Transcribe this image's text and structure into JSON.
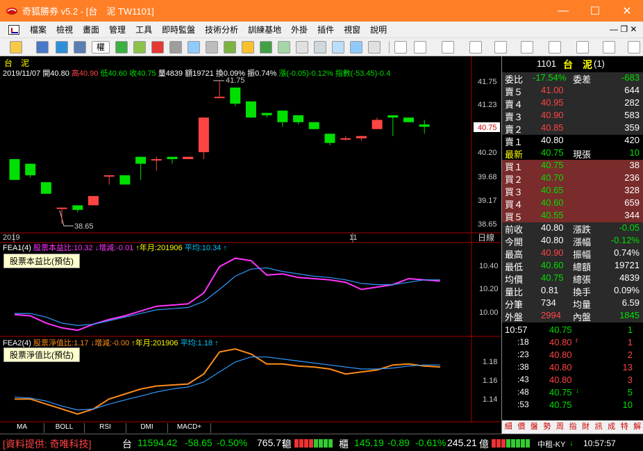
{
  "window": {
    "title": "奇狐勝券 v5.2 - [台　泥 TW1101]",
    "min_glyph": "—",
    "max_glyph": "☐",
    "close_glyph": "✕"
  },
  "menu": [
    "檔案",
    "檢視",
    "畫面",
    "管理",
    "工具",
    "即時監盤",
    "技術分析",
    "訓練基地",
    "外掛",
    "插件",
    "視窗",
    "說明"
  ],
  "mdi_controls": "—  ❐  ✕",
  "toolbar": {
    "right_label": "權"
  },
  "chart": {
    "stock_name": "台　泥",
    "header": {
      "date": "2019/11/07",
      "open": "開40.80",
      "high": "高40.90",
      "low": "低40.60",
      "close": "收40.75",
      "vol": "量4839",
      "amount": "額19721",
      "turnover": "換0.09%",
      "amplitude": "振0.74%",
      "change": "漲(-0.05)-0.12%",
      "index": "指數(-53.45)-0.4"
    },
    "hl_labels": {
      "high": "41.75",
      "low": "38.65"
    },
    "price_axis": [
      "41.75",
      "41.23",
      "40.70",
      "40.20",
      "39.68",
      "39.17",
      "38.65"
    ],
    "current_price_tag": "40.75",
    "x_labels": {
      "left": "2019",
      "mid": "11"
    },
    "period_label": "日線",
    "fea1": {
      "header_name": "FEA1(4)",
      "header_main": "股票本益比:10.32",
      "header_chg": "↓增減:-0.01",
      "header_month": "↑年月:201906",
      "header_avg": "平均:10.34",
      "header_arrow": "↑",
      "label": "股票本益比(預估)",
      "axis": [
        "10.40",
        "10.20",
        "10.00"
      ]
    },
    "fea2": {
      "header_name": "FEA2(4)",
      "header_main": "股票淨值比:1.17",
      "header_chg": "↓增減:-0.00",
      "header_month": "↑年月:201906",
      "header_avg": "平均:1.18",
      "header_arrow": "↑",
      "label": "股票淨值比(預估)",
      "axis": [
        "1.18",
        "1.16",
        "1.14"
      ]
    },
    "tabs": [
      "MA",
      "BOLL",
      "RSI",
      "DMI",
      "MACD+"
    ]
  },
  "chart_data": {
    "type": "candlestick",
    "ylim": [
      38.65,
      41.75
    ],
    "candles": [
      {
        "o": 40.05,
        "h": 40.05,
        "l": 39.6,
        "c": 39.6
      },
      {
        "o": 39.95,
        "h": 39.95,
        "l": 39.65,
        "c": 39.7
      },
      {
        "o": 39.55,
        "h": 39.55,
        "l": 39.3,
        "c": 39.3
      },
      {
        "o": 39.0,
        "h": 39.0,
        "l": 38.65,
        "c": 39.0
      },
      {
        "o": 39.05,
        "h": 39.05,
        "l": 38.9,
        "c": 38.95
      },
      {
        "o": 39.05,
        "h": 39.25,
        "l": 39.05,
        "c": 39.25
      },
      {
        "o": 39.7,
        "h": 39.7,
        "l": 39.5,
        "c": 39.7
      },
      {
        "o": 39.7,
        "h": 39.7,
        "l": 39.5,
        "c": 39.5
      },
      {
        "o": 40.1,
        "h": 40.1,
        "l": 39.6,
        "c": 39.95
      },
      {
        "o": 40.05,
        "h": 40.1,
        "l": 39.8,
        "c": 40.05
      },
      {
        "o": 40.1,
        "h": 40.1,
        "l": 39.95,
        "c": 40.05
      },
      {
        "o": 40.05,
        "h": 40.1,
        "l": 40.05,
        "c": 40.1
      },
      {
        "o": 40.2,
        "h": 40.95,
        "l": 40.05,
        "c": 40.95
      },
      {
        "o": 41.4,
        "h": 41.75,
        "l": 41.4,
        "c": 41.4
      },
      {
        "o": 41.6,
        "h": 41.6,
        "l": 41.2,
        "c": 41.25
      },
      {
        "o": 41.3,
        "h": 41.3,
        "l": 40.95,
        "c": 40.95
      },
      {
        "o": 41.05,
        "h": 41.05,
        "l": 40.95,
        "c": 41.0
      },
      {
        "o": 41.1,
        "h": 41.1,
        "l": 40.75,
        "c": 40.85
      },
      {
        "o": 41.0,
        "h": 41.0,
        "l": 40.8,
        "c": 40.85
      },
      {
        "o": 40.85,
        "h": 40.85,
        "l": 40.7,
        "c": 40.7
      },
      {
        "o": 40.6,
        "h": 40.6,
        "l": 40.35,
        "c": 40.4
      },
      {
        "o": 40.5,
        "h": 40.55,
        "l": 40.45,
        "c": 40.5
      },
      {
        "o": 40.5,
        "h": 40.55,
        "l": 40.45,
        "c": 40.55
      },
      {
        "o": 40.7,
        "h": 40.95,
        "l": 40.7,
        "c": 40.9
      },
      {
        "o": 41.0,
        "h": 41.0,
        "l": 40.55,
        "c": 40.95
      },
      {
        "o": 40.95,
        "h": 40.95,
        "l": 40.85,
        "c": 40.85
      },
      {
        "o": 40.8,
        "h": 40.9,
        "l": 40.6,
        "c": 40.75
      }
    ],
    "fea1": {
      "ylim": [
        9.9,
        10.56
      ],
      "series": [
        {
          "name": "股票本益比",
          "values": [
            10.04,
            10.03,
            9.97,
            9.93,
            9.91,
            9.96,
            10.0,
            10.03,
            10.07,
            10.11,
            10.12,
            10.13,
            10.22,
            10.44,
            10.51,
            10.49,
            10.37,
            10.38,
            10.35,
            10.34,
            10.33,
            10.31,
            10.25,
            10.27,
            10.29,
            10.34,
            10.33,
            10.32
          ]
        },
        {
          "name": "平均",
          "values": [
            10.05,
            10.05,
            10.02,
            9.97,
            9.95,
            9.96,
            9.99,
            10.02,
            10.05,
            10.08,
            10.09,
            10.1,
            10.15,
            10.25,
            10.36,
            10.42,
            10.43,
            10.4,
            10.38,
            10.36,
            10.35,
            10.33,
            10.3,
            10.29,
            10.29,
            10.31,
            10.33,
            10.33
          ]
        }
      ]
    },
    "fea2": {
      "ylim": [
        1.125,
        1.2
      ],
      "series": [
        {
          "name": "股票淨值比",
          "values": [
            1.145,
            1.145,
            1.14,
            1.135,
            1.13,
            1.135,
            1.145,
            1.15,
            1.155,
            1.158,
            1.159,
            1.16,
            1.17,
            1.192,
            1.195,
            1.19,
            1.18,
            1.18,
            1.178,
            1.177,
            1.175,
            1.17,
            1.172,
            1.174,
            1.179,
            1.18,
            1.178,
            1.177
          ]
        },
        {
          "name": "平均",
          "values": [
            1.147,
            1.146,
            1.143,
            1.138,
            1.134,
            1.135,
            1.14,
            1.144,
            1.148,
            1.152,
            1.155,
            1.157,
            1.162,
            1.172,
            1.182,
            1.187,
            1.187,
            1.185,
            1.183,
            1.181,
            1.179,
            1.177,
            1.175,
            1.175,
            1.176,
            1.178,
            1.179,
            1.179
          ]
        }
      ]
    }
  },
  "quote": {
    "code": "1101",
    "name": "台　泥",
    "suffix": "(1)",
    "ratio_label": "委比",
    "ratio_value": "-17.54%",
    "diff_label": "委差",
    "diff_value": "-683",
    "asks": [
      {
        "label": "賣５",
        "price": "41.00",
        "vol": "644"
      },
      {
        "label": "賣４",
        "price": "40.95",
        "vol": "282"
      },
      {
        "label": "賣３",
        "price": "40.90",
        "vol": "583"
      },
      {
        "label": "賣２",
        "price": "40.85",
        "vol": "359"
      },
      {
        "label": "賣１",
        "price": "40.80",
        "vol": "420"
      }
    ],
    "last_label": "最新",
    "last_price": "40.75",
    "cur_label": "現張",
    "cur_vol": "10",
    "bids": [
      {
        "label": "買１",
        "price": "40.75",
        "vol": "38"
      },
      {
        "label": "買２",
        "price": "40.70",
        "vol": "236"
      },
      {
        "label": "買３",
        "price": "40.65",
        "vol": "328"
      },
      {
        "label": "買４",
        "price": "40.60",
        "vol": "659"
      },
      {
        "label": "買５",
        "price": "40.55",
        "vol": "344"
      }
    ],
    "stats": [
      {
        "l1": "前收",
        "v1": "40.80",
        "l2": "漲跌",
        "v2": "-0.05"
      },
      {
        "l1": "今開",
        "v1": "40.80",
        "l2": "漲幅",
        "v2": "-0.12%"
      },
      {
        "l1": "最高",
        "v1": "40.90",
        "l2": "振幅",
        "v2": "0.74%"
      },
      {
        "l1": "最低",
        "v1": "40.60",
        "l2": "總額",
        "v2": "19721"
      },
      {
        "l1": "均價",
        "v1": "40.75",
        "l2": "總張",
        "v2": "4839"
      },
      {
        "l1": "量比",
        "v1": "0.81",
        "l2": "換手",
        "v2": "0.09%"
      },
      {
        "l1": "分筆",
        "v1": "734",
        "l2": "均量",
        "v2": "6.59"
      },
      {
        "l1": "外盤",
        "v1": "2994",
        "l2": "內盤",
        "v2": "1845"
      }
    ],
    "ticks": [
      {
        "time": "10:57",
        "price": "40.75",
        "vol": "1"
      },
      {
        "time": ":18",
        "price": "40.80",
        "flag": "r",
        "vol": "1"
      },
      {
        "time": ":23",
        "price": "40.80",
        "vol": "2"
      },
      {
        "time": ":38",
        "price": "40.80",
        "vol": "13"
      },
      {
        "time": ":43",
        "price": "40.80",
        "vol": "3"
      },
      {
        "time": ":48",
        "price": "40.75",
        "flag": "↓",
        "vol": "5"
      },
      {
        "time": ":53",
        "price": "40.75",
        "vol": "10"
      }
    ],
    "tabs": [
      "細",
      "價",
      "盤",
      "勢",
      "周",
      "指",
      "財",
      "訊",
      "成",
      "特",
      "解"
    ]
  },
  "status": {
    "provider": "[資料提供: 奇唯科技]",
    "twse_label": "台",
    "twse_idx": "11594.42",
    "twse_chg": "-58.65",
    "twse_pct": "-0.50%",
    "twse_amt": "765.71",
    "twse_unit": "億",
    "otc_label": "櫃",
    "otc_idx": "145.19",
    "otc_chg": "-0.89",
    "otc_pct": "-0.61%",
    "otc_amt": "245.21",
    "otc_unit": "億",
    "ticker": "中租-KY",
    "ticker_arrow": "↓",
    "time": "10:57:57"
  },
  "colors": {
    "up": "#ff4444",
    "down": "#00e000",
    "accent": "#ff7f27",
    "fea_main": "#ff33ff",
    "fea2_main": "#ff8c1a",
    "avg": "#3399ff"
  }
}
